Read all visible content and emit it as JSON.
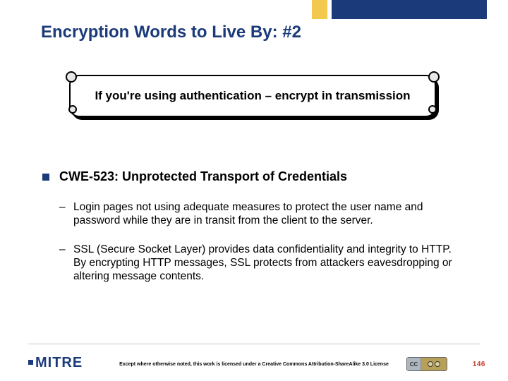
{
  "accent_color": "#1b3a7a",
  "title": "Encryption Words to Live By: #2",
  "callout": "If you're using authentication – encrypt in transmission",
  "point": {
    "heading": "CWE-523: Unprotected Transport of Credentials",
    "subs": [
      "Login pages not using adequate measures to protect the user name and password while they are in transit from the client to the server.",
      "SSL (Secure Socket Layer) provides data confidentiality and integrity to HTTP. By encrypting HTTP messages, SSL protects from attackers eavesdropping or altering message contents."
    ]
  },
  "footer": {
    "logo": "MITRE",
    "license": "Except where otherwise noted, this work is licensed under a Creative Commons Attribution-ShareAlike 3.0 License",
    "cc_label": "CC",
    "page": "146"
  }
}
